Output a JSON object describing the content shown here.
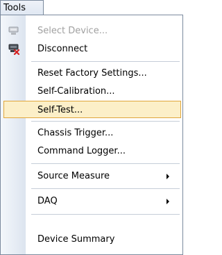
{
  "menubar": {
    "title": "Tools"
  },
  "menu": {
    "select_device": "Select Device...",
    "disconnect": "Disconnect",
    "reset_factory": "Reset Factory Settings...",
    "self_calibration": "Self-Calibration...",
    "self_test": "Self-Test...",
    "chassis_trigger": "Chassis Trigger...",
    "command_logger": "Command Logger...",
    "source_measure": "Source Measure",
    "daq": "DAQ",
    "device_summary": "Device Summary"
  },
  "icons": {
    "select_device": "device-connect-icon",
    "disconnect": "device-disconnect-icon",
    "source_measure_arrow": "chevron-right-icon",
    "daq_arrow": "chevron-right-icon"
  },
  "colors": {
    "hover_fill": "#fcefc8",
    "hover_border": "#e0a53a",
    "disabled_text": "#a0a0a0",
    "disconnect_x": "#d42020"
  }
}
